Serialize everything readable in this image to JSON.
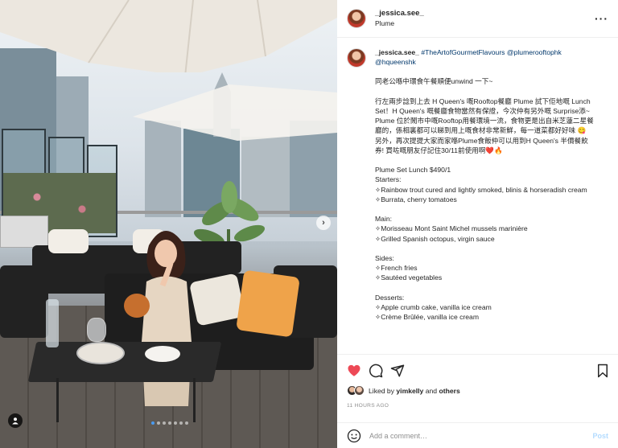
{
  "post": {
    "username": "_jessica.see_",
    "location": "Plume",
    "more_icon": "more-options-icon"
  },
  "caption": {
    "username": "_jessica.see_",
    "hashtag": "#TheArtofGourmetFlavours",
    "mention1": "@plumerooftophk",
    "mention2": "@hqueenshk",
    "text": "同老公喺中環食午餐順便unwind 一下~\n\n行左兩步諗到上去 H Queen's 嘅Rooftop餐廳 Plume 試下佢地嘅 Lunch Set！H Queen's 嘅餐廳食物當然有保證，今次仲有另外嘅 Surprise添~ Plume 位於鬧市中嘅Rooftop用餐環境一流，食物更是出自米芝蓮二星餐廳的，係相裏都可以睇到用上嘅食材非常新鮮，每一道菜都好好味 😋\n另外，再次提提大家而家喺Plume食飯仲可以用到H Queen's 半價餐飲券! 買咗嘅朋友仔記住30/11前使用啊❤️🔥\n\nPlume Set Lunch $490/1\nStarters:\n✧Rainbow trout cured and lightly smoked, blinis & horseradish cream\n✧Burrata, cherry tomatoes\n\nMain:\n✧Morisseau Mont Saint Michel mussels marinière\n✧Grilled Spanish octopus, virgin sauce\n\nSides:\n✧French fries\n✧Sautéed vegetables\n\nDesserts:\n✧Apple crumb cake, vanilla ice cream\n✧Crème Brûlée, vanilla ice cream"
  },
  "engagement": {
    "liked_by_prefix": "Liked by",
    "liked_by_user": "yimkelly",
    "and": "and",
    "others": "others",
    "timestamp": "11 HOURS AGO"
  },
  "comment": {
    "placeholder": "Add a comment…",
    "post_label": "Post"
  },
  "carousel": {
    "total_slides": 7,
    "active_slide": 1
  },
  "colors": {
    "like_red": "#ed4956",
    "link_blue": "#00376b",
    "post_blue": "#b3dbff",
    "carousel_active": "#4a9bf0"
  }
}
